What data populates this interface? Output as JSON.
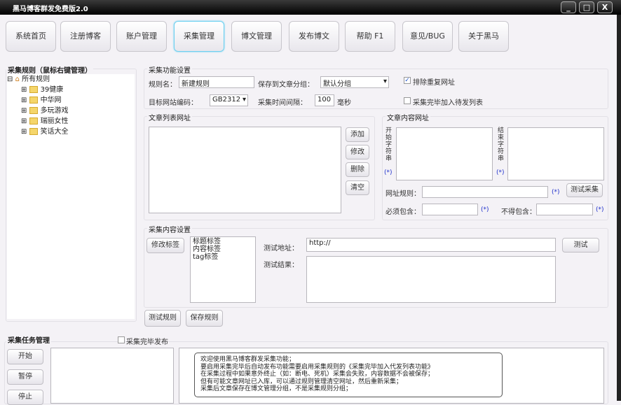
{
  "window": {
    "title": "黑马博客群发免费版2.0",
    "controls": [
      "_",
      "□",
      "X"
    ]
  },
  "toolbar": [
    {
      "label": "系统首页"
    },
    {
      "label": "注册博客"
    },
    {
      "label": "账户管理"
    },
    {
      "label": "采集管理",
      "active": true
    },
    {
      "label": "博文管理"
    },
    {
      "label": "发布博文"
    },
    {
      "label": "帮助 F1"
    },
    {
      "label": "意见/BUG"
    },
    {
      "label": "关于黑马"
    }
  ],
  "rules_tree": {
    "title": "采集规则（鼠标右键管理）",
    "root": "所有规则",
    "items": [
      "39健康",
      "中华网",
      "多玩游戏",
      "瑞丽女性",
      "笑话大全"
    ]
  },
  "function_settings": {
    "title": "采集功能设置",
    "rule_name_label": "规则名：",
    "rule_name_value": "新建规则",
    "save_group_label": "保存到文章分组：",
    "save_group_value": "默认分组",
    "dedupe_label": "排除重复网址",
    "dedupe_checked": true,
    "encoding_label": "目标网站编码：",
    "encoding_value": "GB2312",
    "interval_label": "采集时间间隔：",
    "interval_value": "100",
    "interval_unit": "毫秒",
    "add_to_queue_label": "采集完毕加入待发列表",
    "add_to_queue_checked": false
  },
  "list_urls": {
    "title": "文章列表网址",
    "buttons": [
      "添加",
      "修改",
      "删除",
      "清空"
    ]
  },
  "content_urls": {
    "title": "文章内容网址",
    "start_label": "开始字符串",
    "end_label": "结束字符串",
    "marker": "(*)",
    "url_rule_label": "网址规则：",
    "test_button": "测试采集",
    "must_contain_label": "必须包含：",
    "must_not_contain_label": "不得包含："
  },
  "content_settings": {
    "title": "采集内容设置",
    "edit_tags_button": "修改标签",
    "tags": [
      "标题标签",
      "内容标签",
      "tag标签"
    ],
    "test_url_label": "测试地址：",
    "test_url_value": "http://",
    "test_button": "测试",
    "test_result_label": "测试结果："
  },
  "rule_buttons": {
    "test": "测试规则",
    "save": "保存规则"
  },
  "tasks": {
    "title": "采集任务管理",
    "publish_label": "采集完毕发布",
    "publish_checked": false,
    "buttons": [
      "开始",
      "暂停",
      "停止"
    ],
    "log": [
      "欢迎使用黑马博客群发采集功能；",
      "要启用采集完毕后自动发布功能需要启用采集规则的《采集完毕加入代发列表功能》",
      "在采集过程中如果意外终止（如：断电、死机）采集会失败，内容数据不会被保存；",
      "但有可能文章网址已入库，可以通过规则管理清空网址，然后重新采集；",
      "采集后文章保存在博文管理分组，不是采集规则分组；"
    ]
  }
}
